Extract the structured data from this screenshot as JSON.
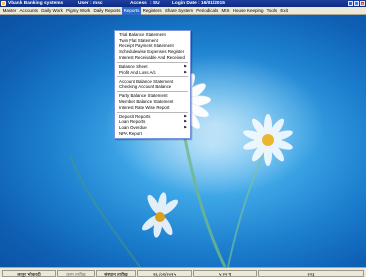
{
  "titlebar": {
    "app_title": "Vbank Banking systems",
    "user_label": "User : msc",
    "access_label": "Access",
    "access_value": ": SU",
    "login_date_label": "Login Date",
    "login_date_value": ": 16/01/2015"
  },
  "menubar": {
    "items": [
      {
        "label": "Master"
      },
      {
        "label": "Accounts"
      },
      {
        "label": "Daily Work"
      },
      {
        "label": "Pigmy Work"
      },
      {
        "label": "Daily Reports"
      },
      {
        "label": "Reports"
      },
      {
        "label": "Registers"
      },
      {
        "label": "Share System"
      },
      {
        "label": "Periodicals"
      },
      {
        "label": "MIS"
      },
      {
        "label": "House Keeping"
      },
      {
        "label": "Tools"
      },
      {
        "label": "Exit"
      }
    ],
    "active_index": 5
  },
  "reports_menu": {
    "items": [
      {
        "label": "Trial Balance Statement",
        "submenu": false
      },
      {
        "label": "Twin Flat Statement",
        "submenu": false
      },
      {
        "label": "Receipt Payment Statement",
        "submenu": false
      },
      {
        "label": "Schedulewise Expenses Register",
        "submenu": false
      },
      {
        "label": "Interest Receivable And Received",
        "submenu": false
      },
      {
        "separator": true
      },
      {
        "label": "Balance Sheet",
        "submenu": true
      },
      {
        "label": "Profit And Loss A/c",
        "submenu": true
      },
      {
        "separator": true
      },
      {
        "label": "Account Balance Statement",
        "submenu": false
      },
      {
        "label": "Checking Account Balance",
        "submenu": false
      },
      {
        "separator": true
      },
      {
        "label": "Party Balance Statement",
        "submenu": false
      },
      {
        "label": "Member Balance Statement",
        "submenu": false
      },
      {
        "label": "Interest Rate Wise Report",
        "submenu": false
      },
      {
        "separator": true
      },
      {
        "label": "Deposit Reports",
        "submenu": true
      },
      {
        "label": "Loan Reports",
        "submenu": true
      },
      {
        "label": "Loan Overdue",
        "submenu": true
      },
      {
        "label": "NPA Report",
        "submenu": false
      }
    ]
  },
  "statusbar": {
    "branch": "लातूर भोकरदी",
    "label_2": "काम तारीख",
    "label_3": "संस्थान तारीख",
    "date": "२६ /०१/२०१५",
    "time": "५:२२ प",
    "num": "२२३"
  },
  "colors": {
    "titlebar": "#0b2b83",
    "menubar": "#ece9d8",
    "menu_highlight": "#316ac5",
    "desktop_sky": "#1c7fce"
  },
  "icons": {
    "app": "bank-app-icon",
    "minimize": "minimize-icon",
    "maximize": "maximize-icon",
    "close": "close-icon",
    "submenu": "chevron-right-icon"
  }
}
